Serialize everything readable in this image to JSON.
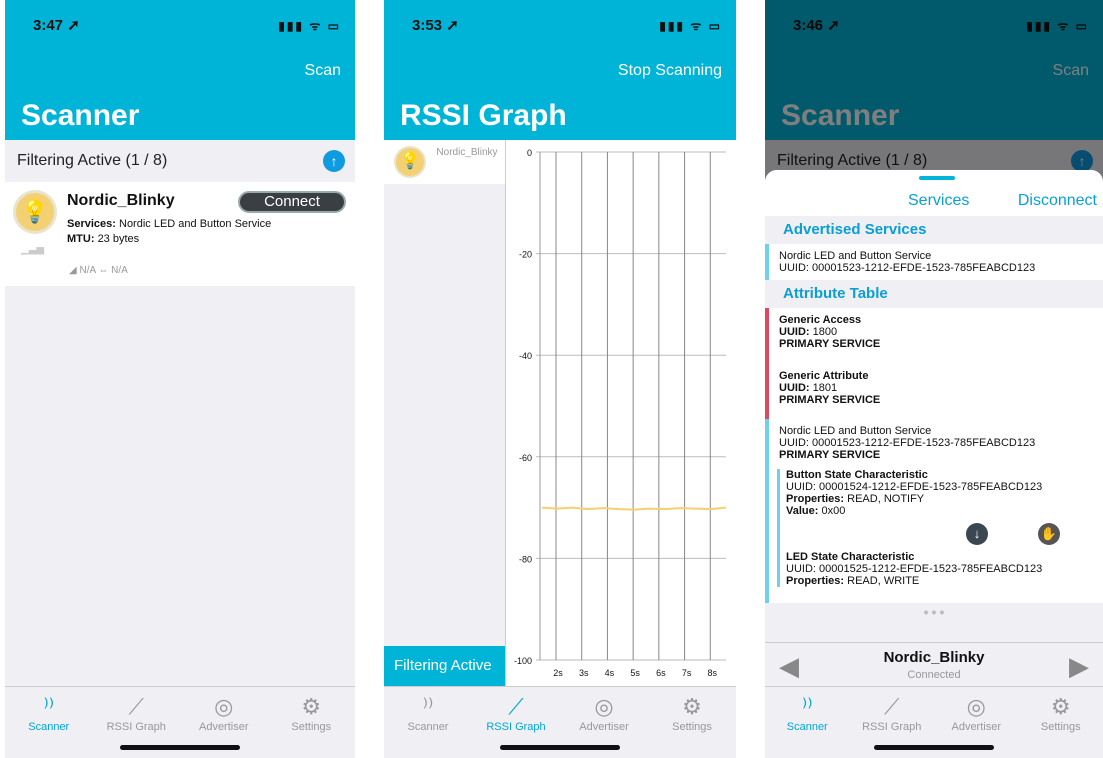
{
  "phone1": {
    "status_time": "3:47 ➚",
    "status_icons": "▮▮▮ ᯤ ▭",
    "nav_button": "Scan",
    "title": "Scanner",
    "filter_text": "Filtering Active (1 / 8)",
    "device": {
      "name": "Nordic_Blinky",
      "connect_label": "Connect",
      "services_label": "Services:",
      "services_value": "Nordic LED and Button Service",
      "mtu_label": "MTU:",
      "mtu_value": "23 bytes",
      "signal_na": "◢ N/A ⇔ N/A"
    }
  },
  "phone2": {
    "status_time": "3:53 ➚",
    "status_icons": "▮▮▮ ᯤ ▭",
    "nav_button": "Stop Scanning",
    "title": "RSSI Graph",
    "list_item": "Nordic_Blinky",
    "filter_button": "Filtering Active"
  },
  "phone3": {
    "status_time": "3:46 ➚",
    "status_icons": "▮▮▮ ᯤ ▭",
    "nav_button": "Scan",
    "title": "Scanner",
    "filter_text": "Filtering Active (1 / 8)",
    "sheet": {
      "services_tab": "Services",
      "disconnect": "Disconnect",
      "advertised_header": "Advertised Services",
      "advertised": {
        "name": "Nordic LED and Button Service",
        "uuid": "UUID: 00001523-1212-EFDE-1523-785FEABCD123"
      },
      "attribute_header": "Attribute Table",
      "services": [
        {
          "name": "Generic Access",
          "uuid_label": "UUID:",
          "uuid": "1800",
          "type": "PRIMARY SERVICE",
          "color": "#e04860"
        },
        {
          "name": "Generic Attribute",
          "uuid_label": "UUID:",
          "uuid": "1801",
          "type": "PRIMARY SERVICE",
          "color": "#e04860"
        },
        {
          "name": "Nordic LED and Button Service",
          "uuid_label": "UUID:",
          "uuid": "00001523-1212-EFDE-1523-785FEABCD123",
          "type": "PRIMARY SERVICE",
          "color": "#6ed0ea"
        }
      ],
      "characteristics": [
        {
          "name": "Button State Characteristic",
          "uuid": "UUID: 00001524-1212-EFDE-1523-785FEABCD123",
          "props_label": "Properties:",
          "props": "READ, NOTIFY",
          "value_label": "Value:",
          "value": "0x00"
        },
        {
          "name": "LED State Characteristic",
          "uuid": "UUID: 00001525-1212-EFDE-1523-785FEABCD123",
          "props_label": "Properties:",
          "props": "READ, WRITE"
        }
      ],
      "pager": "● ● ●"
    },
    "device_bar": {
      "name": "Nordic_Blinky",
      "status": "Connected"
    }
  },
  "tabs": [
    {
      "label": "Scanner",
      "icon": "scanner-icon"
    },
    {
      "label": "RSSI Graph",
      "icon": "graph-icon"
    },
    {
      "label": "Advertiser",
      "icon": "advertiser-icon"
    },
    {
      "label": "Settings",
      "icon": "settings-icon"
    }
  ],
  "chart_data": {
    "type": "line",
    "title": "",
    "xlabel": "",
    "ylabel": "",
    "x_ticks": [
      "2s",
      "3s",
      "4s",
      "5s",
      "6s",
      "7s",
      "8s"
    ],
    "y_ticks": [
      "0",
      "-20",
      "-40",
      "-60",
      "-80",
      "-100"
    ],
    "ylim": [
      -100,
      0
    ],
    "series": [
      {
        "values": [
          -70,
          -70.2,
          -70,
          -70.3,
          -70.1,
          -70.3,
          -70.4,
          -70.2,
          -70.3,
          -70.1,
          -70.2,
          -70.3,
          -70
        ]
      }
    ],
    "grid": true,
    "line_color": "#f3d173"
  }
}
